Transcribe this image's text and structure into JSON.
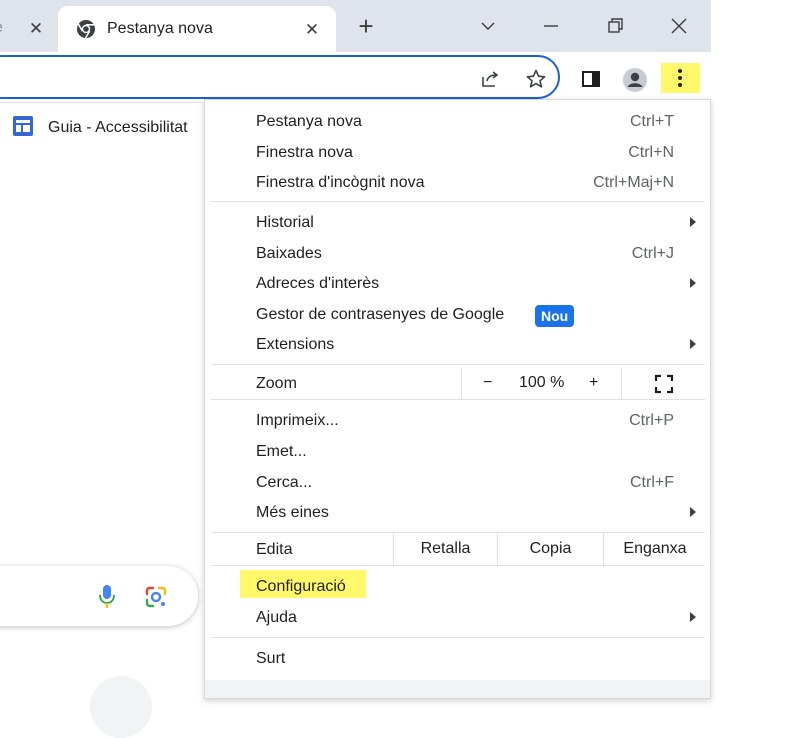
{
  "tabs": {
    "partial_tab_text": "e",
    "active_tab_title": "Pestanya nova"
  },
  "window_controls": [
    "chevron-down-icon",
    "minimize-icon",
    "restore-icon",
    "close-icon"
  ],
  "toolbar_icons": [
    "share-icon",
    "star-icon",
    "side-panel-icon",
    "profile-icon",
    "more-vertical-icon"
  ],
  "bookmarks": {
    "item": "Guia - Accessibilitat"
  },
  "colors": {
    "highlight": "#fff86a",
    "accent": "#1a73e8",
    "tabstrip": "#dfe3eb"
  },
  "menu": {
    "group1": [
      {
        "label": "Pestanya nova",
        "shortcut": "Ctrl+T"
      },
      {
        "label": "Finestra nova",
        "shortcut": "Ctrl+N"
      },
      {
        "label": "Finestra d'incògnit nova",
        "shortcut": "Ctrl+Maj+N"
      }
    ],
    "group2": [
      {
        "label": "Historial"
      },
      {
        "label": "Baixades",
        "shortcut": "Ctrl+J"
      },
      {
        "label": "Adreces d'interès"
      },
      {
        "label": "Gestor de contrasenyes de Google",
        "badge": "Nou"
      },
      {
        "label": "Extensions"
      }
    ],
    "zoom": {
      "label": "Zoom",
      "minus": "−",
      "value": "100 %",
      "plus": "+"
    },
    "group3": [
      {
        "label": "Imprimeix...",
        "shortcut": "Ctrl+P"
      },
      {
        "label": "Emet..."
      },
      {
        "label": "Cerca...",
        "shortcut": "Ctrl+F"
      },
      {
        "label": "Més eines"
      }
    ],
    "edit": {
      "label": "Edita",
      "cut": "Retalla",
      "copy": "Copia",
      "paste": "Enganxa"
    },
    "group4": [
      {
        "label": "Configuració"
      },
      {
        "label": "Ajuda"
      }
    ],
    "exit": {
      "label": "Surt"
    }
  }
}
